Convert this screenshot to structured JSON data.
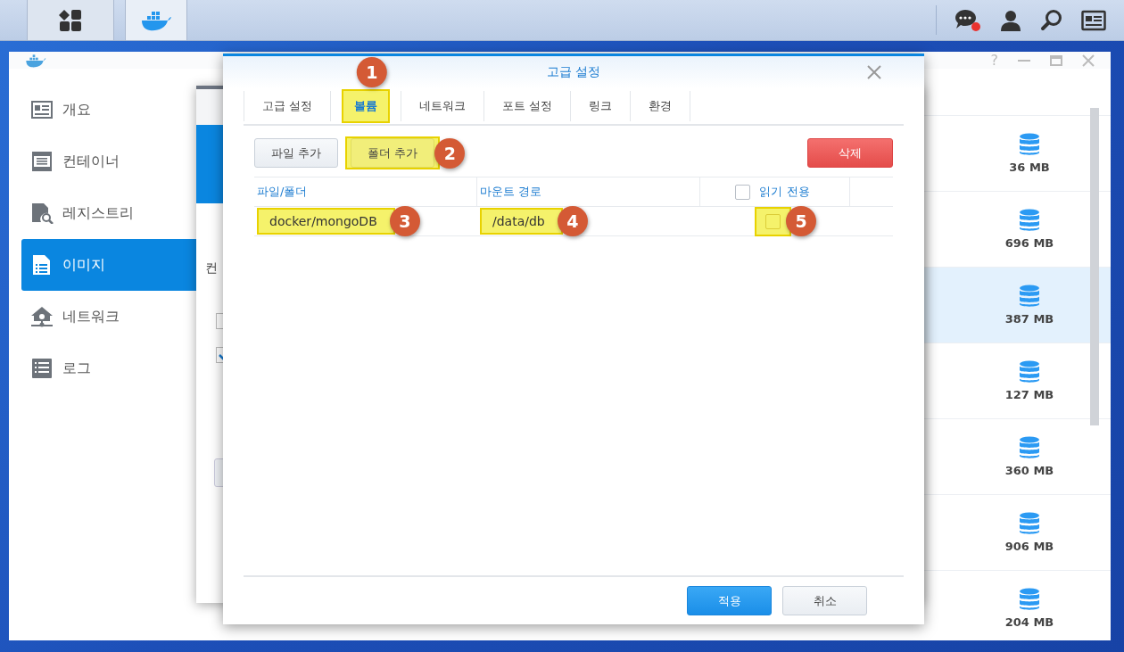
{
  "taskbar": {
    "buttons": [
      {
        "kind": "main-menu",
        "selected": false
      },
      {
        "kind": "docker",
        "selected": true
      }
    ],
    "notification": true
  },
  "main_window": {
    "help_label": "?",
    "sidebar": [
      {
        "label": "개요",
        "selected": false
      },
      {
        "label": "컨테이너",
        "selected": false
      },
      {
        "label": "레지스트리",
        "selected": false
      },
      {
        "label": "이미지",
        "selected": true
      },
      {
        "label": "네트워크",
        "selected": false
      },
      {
        "label": "로그",
        "selected": false
      }
    ],
    "image_sizes": [
      {
        "size": "36 MB",
        "selected": false
      },
      {
        "size": "696 MB",
        "selected": false
      },
      {
        "size": "387 MB",
        "selected": true
      },
      {
        "size": "127 MB",
        "selected": false
      },
      {
        "size": "360 MB",
        "selected": false
      },
      {
        "size": "906 MB",
        "selected": false
      },
      {
        "size": "204 MB",
        "selected": false
      }
    ]
  },
  "background_dialog": {
    "partial_text": "컨",
    "checkboxes": [
      {
        "checked": false
      },
      {
        "checked": true
      }
    ]
  },
  "dialog": {
    "title": "고급 설정",
    "tabs": [
      {
        "label": "고급 설정",
        "selected": false,
        "highlighted": false
      },
      {
        "label": "볼륨",
        "selected": true,
        "highlighted": true,
        "callout": "1"
      },
      {
        "label": "네트워크",
        "selected": false,
        "highlighted": false
      },
      {
        "label": "포트 설정",
        "selected": false,
        "highlighted": false
      },
      {
        "label": "링크",
        "selected": false,
        "highlighted": false
      },
      {
        "label": "환경",
        "selected": false,
        "highlighted": false
      }
    ],
    "toolbar": [
      {
        "label": "파일 추가",
        "kind": "default",
        "highlighted": false
      },
      {
        "label": "폴더 추가",
        "kind": "default",
        "highlighted": true,
        "callout": "2"
      },
      {
        "label": "삭제",
        "kind": "danger",
        "highlighted": false
      }
    ],
    "table": {
      "columns": [
        {
          "label": "파일/폴더",
          "kind": "text"
        },
        {
          "label": "마운트 경로",
          "kind": "text"
        },
        {
          "label": "읽기 전용",
          "kind": "checkbox",
          "checked": false
        }
      ],
      "rows": [
        {
          "file": {
            "text": "docker/mongoDB",
            "highlighted": true,
            "callout": "3"
          },
          "mount": {
            "text": "/data/db",
            "highlighted": true,
            "callout": "4"
          },
          "read_only": {
            "checked": false,
            "highlighted": true,
            "callout": "5"
          }
        }
      ]
    },
    "footer_buttons": [
      {
        "label": "적용",
        "kind": "primary"
      },
      {
        "label": "취소",
        "kind": "default"
      }
    ]
  }
}
